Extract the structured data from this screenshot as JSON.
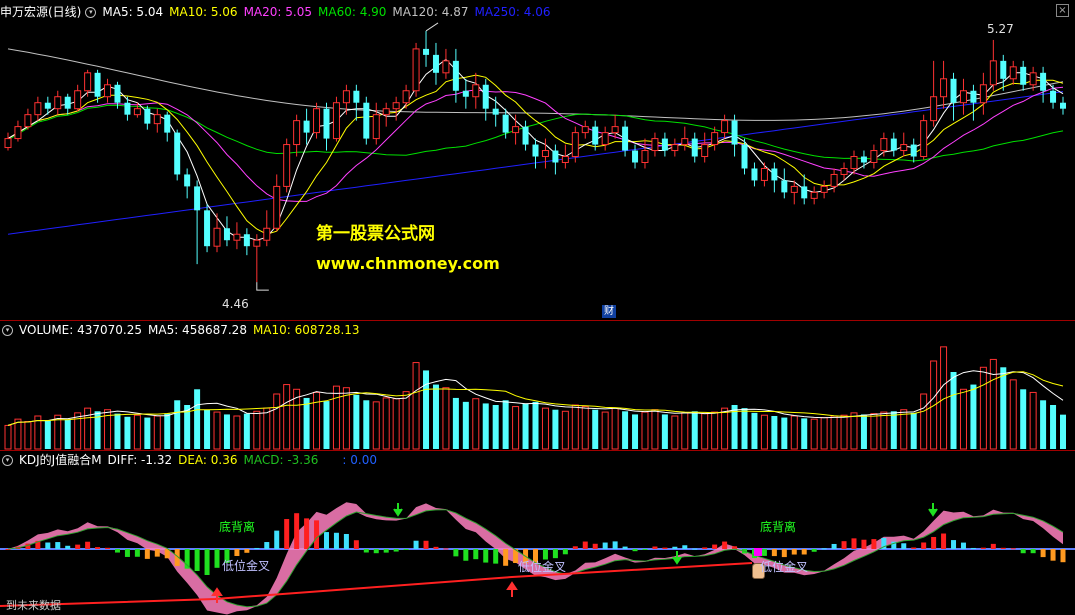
{
  "price_header": {
    "title": "申万宏源(日线)",
    "ma5": "MA5: 5.04",
    "ma10": "MA10: 5.06",
    "ma20": "MA20: 5.05",
    "ma60": "MA60: 4.90",
    "ma120": "MA120: 4.87",
    "ma250": "MA250: 4.06"
  },
  "price_annotations": {
    "high": "5.27",
    "low": "4.46",
    "cai_marker": "财"
  },
  "watermark": {
    "line1": "第一股票公式网",
    "line2": "www.chnmoney.com"
  },
  "volume_header": {
    "title": "VOLUME: 437070.25",
    "ma5": "MA5: 458687.28",
    "ma10": "MA10: 608728.13"
  },
  "indicator_header": {
    "title": "KDJ的J值融合M",
    "diff": "DIFF: -1.32",
    "dea": "DEA: 0.36",
    "macd": "MACD: -3.36",
    "extra": ": 0.00"
  },
  "indicator_labels": {
    "top_div_1": "底背离",
    "low_cross_1": "低位金叉",
    "low_cross_2": "低位金叉",
    "top_div_2": "底背离",
    "low_cross_3": "低位金叉",
    "footer": "到未来数据"
  },
  "colors": {
    "up": "#ff3232",
    "down": "#54ffff",
    "ma5": "#ffffff",
    "ma10": "#ffff00",
    "ma20": "#ff40ff",
    "ma60": "#00e000",
    "ma120": "#c0c0c0",
    "ma250": "#2020ff",
    "separator": "#a00000"
  },
  "chart_data": {
    "type": "candlestick",
    "symbol": "申万宏源",
    "period": "日线",
    "candles": [
      [
        4.91,
        4.94,
        4.9,
        4.96
      ],
      [
        4.94,
        4.98,
        4.93,
        5.0
      ],
      [
        4.98,
        5.02,
        4.97,
        5.04
      ],
      [
        5.02,
        5.06,
        5.0,
        5.08
      ],
      [
        5.06,
        5.04,
        5.02,
        5.08
      ],
      [
        5.04,
        5.08,
        5.02,
        5.1
      ],
      [
        5.08,
        5.04,
        5.02,
        5.09
      ],
      [
        5.04,
        5.1,
        5.03,
        5.12
      ],
      [
        5.1,
        5.16,
        5.08,
        5.17
      ],
      [
        5.16,
        5.08,
        5.06,
        5.17
      ],
      [
        5.08,
        5.12,
        5.06,
        5.14
      ],
      [
        5.12,
        5.06,
        5.04,
        5.13
      ],
      [
        5.06,
        5.02,
        5.0,
        5.08
      ],
      [
        5.02,
        5.04,
        5.01,
        5.06
      ],
      [
        5.04,
        4.99,
        4.97,
        5.05
      ],
      [
        4.99,
        5.02,
        4.96,
        5.04
      ],
      [
        5.02,
        4.96,
        4.93,
        5.03
      ],
      [
        4.96,
        4.82,
        4.8,
        4.97
      ],
      [
        4.82,
        4.78,
        4.74,
        4.84
      ],
      [
        4.78,
        4.7,
        4.52,
        4.8
      ],
      [
        4.7,
        4.58,
        4.56,
        4.72
      ],
      [
        4.58,
        4.64,
        4.56,
        4.69
      ],
      [
        4.64,
        4.6,
        4.58,
        4.68
      ],
      [
        4.6,
        4.62,
        4.57,
        4.66
      ],
      [
        4.62,
        4.58,
        4.55,
        4.64
      ],
      [
        4.58,
        4.6,
        4.46,
        4.62
      ],
      [
        4.6,
        4.64,
        4.58,
        4.7
      ],
      [
        4.64,
        4.78,
        4.63,
        4.82
      ],
      [
        4.78,
        4.92,
        4.76,
        4.94
      ],
      [
        4.92,
        5.0,
        4.88,
        5.02
      ],
      [
        5.0,
        4.96,
        4.92,
        5.04
      ],
      [
        4.96,
        5.04,
        4.94,
        5.06
      ],
      [
        5.04,
        4.94,
        4.9,
        5.06
      ],
      [
        4.94,
        5.06,
        4.93,
        5.08
      ],
      [
        5.06,
        5.1,
        5.02,
        5.12
      ],
      [
        5.1,
        5.06,
        5.0,
        5.12
      ],
      [
        5.06,
        4.94,
        4.92,
        5.08
      ],
      [
        4.94,
        5.02,
        4.92,
        5.06
      ],
      [
        5.02,
        5.04,
        4.98,
        5.06
      ],
      [
        5.04,
        5.06,
        5.0,
        5.08
      ],
      [
        5.06,
        5.1,
        5.04,
        5.12
      ],
      [
        5.1,
        5.24,
        5.08,
        5.26
      ],
      [
        5.24,
        5.22,
        5.18,
        5.3
      ],
      [
        5.22,
        5.16,
        5.12,
        5.26
      ],
      [
        5.16,
        5.2,
        5.14,
        5.24
      ],
      [
        5.2,
        5.1,
        5.06,
        5.24
      ],
      [
        5.1,
        5.08,
        5.04,
        5.14
      ],
      [
        5.08,
        5.12,
        5.04,
        5.16
      ],
      [
        5.12,
        5.04,
        5.0,
        5.14
      ],
      [
        5.04,
        5.02,
        4.98,
        5.08
      ],
      [
        5.02,
        4.96,
        4.94,
        5.04
      ],
      [
        4.96,
        4.98,
        4.92,
        5.02
      ],
      [
        4.98,
        4.92,
        4.9,
        5.0
      ],
      [
        4.92,
        4.88,
        4.84,
        4.94
      ],
      [
        4.88,
        4.9,
        4.84,
        4.94
      ],
      [
        4.9,
        4.86,
        4.82,
        4.92
      ],
      [
        4.86,
        4.88,
        4.84,
        4.92
      ],
      [
        4.88,
        4.96,
        4.86,
        4.98
      ],
      [
        4.96,
        4.98,
        4.94,
        5.0
      ],
      [
        4.98,
        4.92,
        4.9,
        5.0
      ],
      [
        4.92,
        4.96,
        4.9,
        4.98
      ],
      [
        4.96,
        4.98,
        4.94,
        5.02
      ],
      [
        4.98,
        4.9,
        4.88,
        5.0
      ],
      [
        4.9,
        4.86,
        4.84,
        4.92
      ],
      [
        4.86,
        4.9,
        4.84,
        4.94
      ],
      [
        4.9,
        4.94,
        4.88,
        4.96
      ],
      [
        4.94,
        4.9,
        4.88,
        4.96
      ],
      [
        4.9,
        4.92,
        4.88,
        4.94
      ],
      [
        4.92,
        4.94,
        4.9,
        4.98
      ],
      [
        4.94,
        4.88,
        4.86,
        4.96
      ],
      [
        4.88,
        4.92,
        4.86,
        4.96
      ],
      [
        4.92,
        4.96,
        4.9,
        4.98
      ],
      [
        4.96,
        5.0,
        4.94,
        5.02
      ],
      [
        5.0,
        4.92,
        4.88,
        5.02
      ],
      [
        4.92,
        4.84,
        4.82,
        4.94
      ],
      [
        4.84,
        4.8,
        4.78,
        4.86
      ],
      [
        4.8,
        4.84,
        4.78,
        4.86
      ],
      [
        4.84,
        4.8,
        4.76,
        4.86
      ],
      [
        4.8,
        4.76,
        4.74,
        4.84
      ],
      [
        4.76,
        4.78,
        4.72,
        4.8
      ],
      [
        4.78,
        4.74,
        4.72,
        4.82
      ],
      [
        4.74,
        4.76,
        4.72,
        4.78
      ],
      [
        4.76,
        4.78,
        4.74,
        4.8
      ],
      [
        4.78,
        4.82,
        4.76,
        4.84
      ],
      [
        4.82,
        4.84,
        4.8,
        4.86
      ],
      [
        4.84,
        4.88,
        4.82,
        4.9
      ],
      [
        4.88,
        4.86,
        4.84,
        4.9
      ],
      [
        4.86,
        4.9,
        4.84,
        4.92
      ],
      [
        4.9,
        4.94,
        4.88,
        4.96
      ],
      [
        4.94,
        4.9,
        4.88,
        4.96
      ],
      [
        4.9,
        4.92,
        4.88,
        4.96
      ],
      [
        4.92,
        4.88,
        4.86,
        4.94
      ],
      [
        4.88,
        5.0,
        4.87,
        5.02
      ],
      [
        5.0,
        5.08,
        4.98,
        5.2
      ],
      [
        5.08,
        5.14,
        5.04,
        5.2
      ],
      [
        5.14,
        5.06,
        5.0,
        5.16
      ],
      [
        5.06,
        5.1,
        5.02,
        5.14
      ],
      [
        5.1,
        5.06,
        5.0,
        5.12
      ],
      [
        5.06,
        5.12,
        5.02,
        5.16
      ],
      [
        5.12,
        5.2,
        5.1,
        5.27
      ],
      [
        5.2,
        5.14,
        5.1,
        5.22
      ],
      [
        5.14,
        5.18,
        5.12,
        5.2
      ],
      [
        5.18,
        5.12,
        5.1,
        5.2
      ],
      [
        5.12,
        5.16,
        5.1,
        5.18
      ],
      [
        5.16,
        5.1,
        5.06,
        5.18
      ],
      [
        5.1,
        5.06,
        5.04,
        5.12
      ],
      [
        5.06,
        5.04,
        5.02,
        5.08
      ]
    ],
    "volume": [
      300000,
      380000,
      350000,
      420000,
      360000,
      430000,
      370000,
      460000,
      520000,
      480000,
      500000,
      450000,
      410000,
      430000,
      400000,
      420000,
      450000,
      620000,
      560000,
      760000,
      500000,
      470000,
      440000,
      420000,
      450000,
      480000,
      520000,
      700000,
      820000,
      760000,
      650000,
      720000,
      610000,
      800000,
      780000,
      690000,
      620000,
      600000,
      650000,
      640000,
      730000,
      1100000,
      1000000,
      820000,
      780000,
      650000,
      600000,
      640000,
      580000,
      560000,
      620000,
      540000,
      580000,
      600000,
      520000,
      500000,
      480000,
      560000,
      540000,
      500000,
      470000,
      520000,
      480000,
      440000,
      470000,
      500000,
      440000,
      420000,
      460000,
      480000,
      450000,
      470000,
      520000,
      560000,
      520000,
      460000,
      430000,
      420000,
      400000,
      420000,
      390000,
      380000,
      400000,
      420000,
      430000,
      460000,
      440000,
      450000,
      470000,
      480000,
      500000,
      460000,
      700000,
      1120000,
      1300000,
      980000,
      760000,
      820000,
      1040000,
      1140000,
      1040000,
      880000,
      760000,
      720000,
      620000,
      560000,
      437070
    ],
    "ma": {
      "MA5": 5.04,
      "MA10": 5.06,
      "MA20": 5.05,
      "MA60": 4.9,
      "MA120": 4.87,
      "MA250": 4.06
    },
    "volume_ma": {
      "VOLUME": 437070.25,
      "MA5": 458687.28,
      "MA10": 608728.13
    },
    "indicator": {
      "DIFF": -1.32,
      "DEA": 0.36,
      "MACD": -3.36
    },
    "ylim_price": [
      4.46,
      5.27
    ]
  }
}
